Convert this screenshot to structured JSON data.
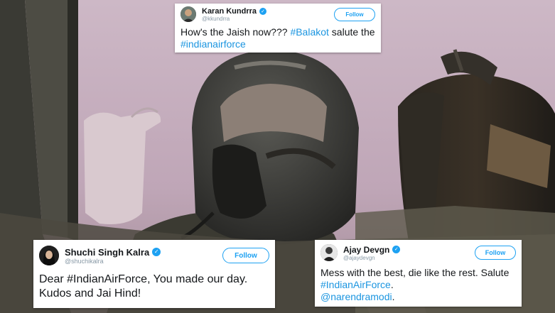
{
  "colors": {
    "twitter_blue": "#1da1f2",
    "hashtag_blue": "#1b95e0",
    "text_dark": "#14171a",
    "handle_gray": "#8899a6",
    "sky_pink": "#c9b3c3"
  },
  "background": {
    "scene": "pilot-in-cockpit-photo",
    "icons": [
      "pilot-helmet-icon",
      "oxygen-mask-icon",
      "thumbs-up-hand-icon",
      "ejection-seat-icon"
    ]
  },
  "tweets": [
    {
      "name": "Karan Kundrra",
      "handle": "@kkundrra",
      "follow_label": "Follow",
      "verified_icon": "verified-badge-icon",
      "text_plain": "How's the Jaish now??? ",
      "hashtag_1": "#Balakot",
      "text_mid": " salute the",
      "hashtag_2": "#indianairforce"
    },
    {
      "name": "Shuchi Singh Kalra",
      "handle": "@shuchikalra",
      "follow_label": "Follow",
      "verified_icon": "verified-badge-icon",
      "text_line_1": "Dear #IndianAirForce, You made our day.",
      "text_line_2": "Kudos and Jai Hind!"
    },
    {
      "name": "Ajay Devgn",
      "handle": "@ajaydevgn",
      "follow_label": "Follow",
      "verified_icon": "verified-badge-icon",
      "text_line_1": "Mess with the best, die like the rest. Salute",
      "hashtag_1": "#IndianAirForce",
      "after_hashtag": ".",
      "mention": "@narendramodi",
      "after_mention": "."
    }
  ]
}
